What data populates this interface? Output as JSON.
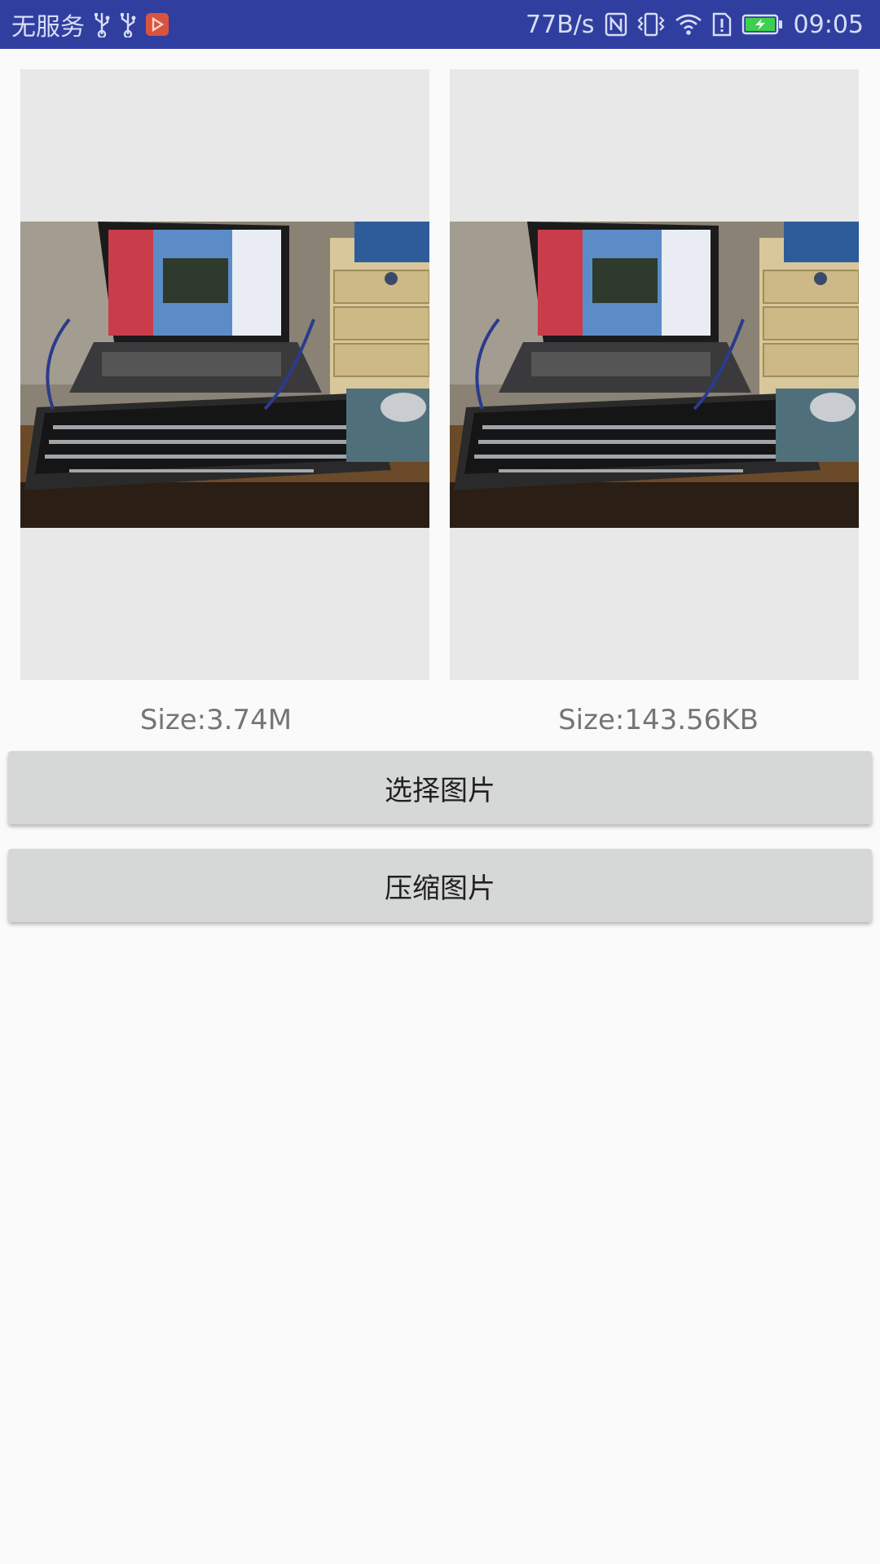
{
  "status_bar": {
    "carrier": "无服务",
    "net_speed": "77B/s",
    "time": "09:05",
    "left_icons": [
      "usb-icon",
      "usb-icon",
      "app-notification-icon"
    ],
    "right_icons": [
      "nfc-icon",
      "vibrate-icon",
      "wifi-icon",
      "sim-alert-icon",
      "battery-charging-icon"
    ],
    "background_color": "#303f9f"
  },
  "images": {
    "original_size": "Size:3.74M",
    "compressed_size": "Size:143.56KB"
  },
  "buttons": {
    "select_label": "选择图片",
    "compress_label": "压缩图片"
  }
}
